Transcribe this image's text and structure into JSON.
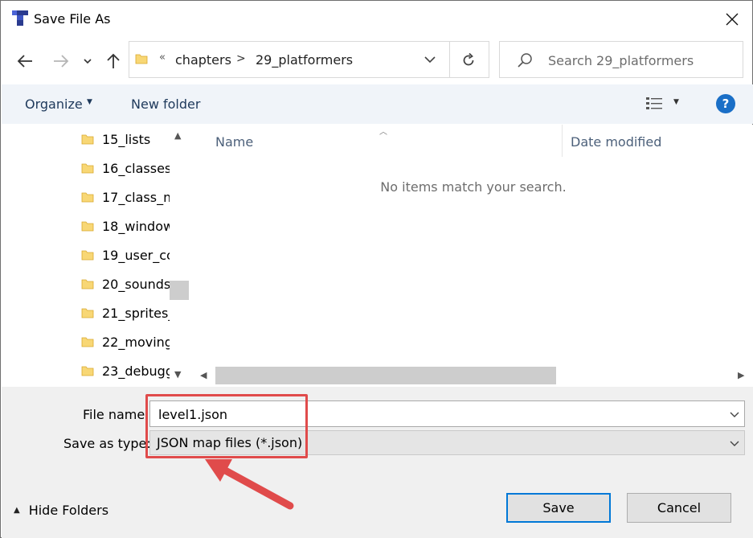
{
  "window": {
    "title": "Save File As"
  },
  "address_bar": {
    "overflow_glyph": "«",
    "breadcrumbs": [
      "chapters",
      "29_platformers"
    ],
    "separator": ">"
  },
  "search": {
    "placeholder": "Search 29_platformers"
  },
  "toolbar": {
    "organize_label": "Organize",
    "new_folder_label": "New folder",
    "help_label": "?"
  },
  "nav_pane": {
    "items": [
      {
        "label": "15_lists"
      },
      {
        "label": "16_classes"
      },
      {
        "label": "17_class_m"
      },
      {
        "label": "18_window"
      },
      {
        "label": "19_user_cc"
      },
      {
        "label": "20_sounds"
      },
      {
        "label": "21_sprites_"
      },
      {
        "label": "22_moving"
      },
      {
        "label": "23_debugg"
      }
    ]
  },
  "file_list": {
    "columns": [
      "Name",
      "Date modified"
    ],
    "empty_message": "No items match your search."
  },
  "form": {
    "file_name_label": "File name:",
    "file_name_value": "level1.json",
    "save_type_label": "Save as type:",
    "save_type_value": "JSON map files (*.json)"
  },
  "footer": {
    "hide_folders_label": "Hide Folders",
    "save_label": "Save",
    "cancel_label": "Cancel"
  },
  "colors": {
    "accent": "#0078d7",
    "toolbar_bg": "#f0f4f9",
    "highlight": "#e04b4b",
    "folder": "#f8d775"
  },
  "icons": [
    "app-icon",
    "close-icon",
    "back-arrow-icon",
    "forward-arrow-icon",
    "recent-chevron-icon",
    "up-arrow-icon",
    "folder-icon",
    "chevron-down-icon",
    "refresh-icon",
    "search-icon",
    "view-details-icon",
    "help-icon"
  ]
}
